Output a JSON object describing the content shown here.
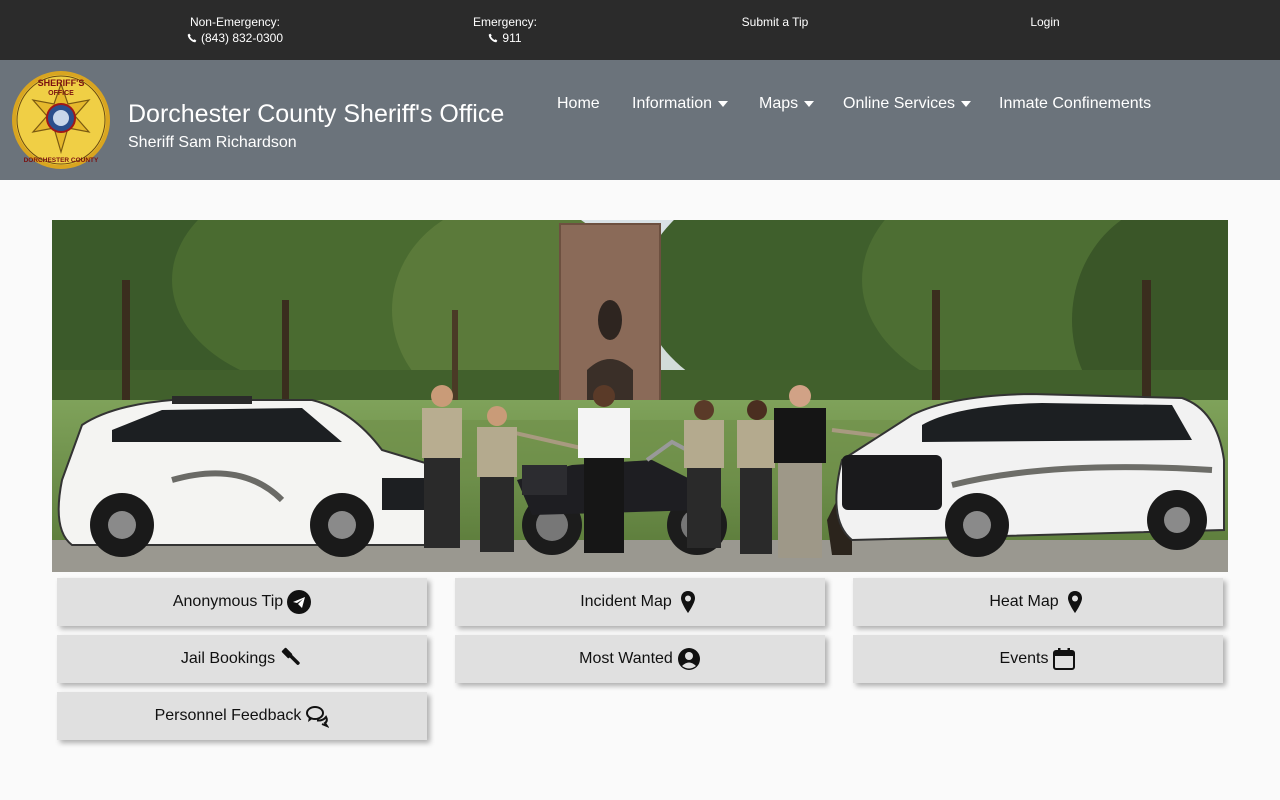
{
  "topbar": {
    "non_emergency_label": "Non-Emergency:",
    "non_emergency_phone": "(843) 832-0300",
    "emergency_label": "Emergency:",
    "emergency_phone": "911",
    "submit_tip": "Submit a Tip",
    "login": "Login"
  },
  "header": {
    "title": "Dorchester County Sheriff's Office",
    "subtitle": "Sheriff Sam Richardson",
    "badge_text_top": "SHERIFF'S",
    "badge_text_office": "OFFICE",
    "badge_text_bottom": "DORCHESTER COUNTY"
  },
  "nav": {
    "home": "Home",
    "information": "Information",
    "maps": "Maps",
    "online_services": "Online Services",
    "inmate_confinements": "Inmate Confinements"
  },
  "tiles": {
    "anonymous_tip": "Anonymous Tip",
    "incident_map": "Incident Map",
    "heat_map": "Heat Map",
    "jail_bookings": "Jail Bookings",
    "most_wanted": "Most Wanted",
    "events": "Events",
    "personnel_feedback": "Personnel Feedback"
  },
  "icons": {
    "phone": "phone-icon",
    "caret": "caret-down-icon",
    "anonymous_tip": "paper-plane-icon",
    "incident_map": "map-marker-icon",
    "heat_map": "map-marker-icon",
    "jail_bookings": "gavel-icon",
    "most_wanted": "user-circle-icon",
    "events": "calendar-icon",
    "personnel_feedback": "comments-icon"
  },
  "colors": {
    "topbar_bg": "#2b2b2b",
    "header_bg": "#6b737b",
    "tile_bg": "#e0e0e0",
    "badge_gold": "#e8c23a"
  }
}
